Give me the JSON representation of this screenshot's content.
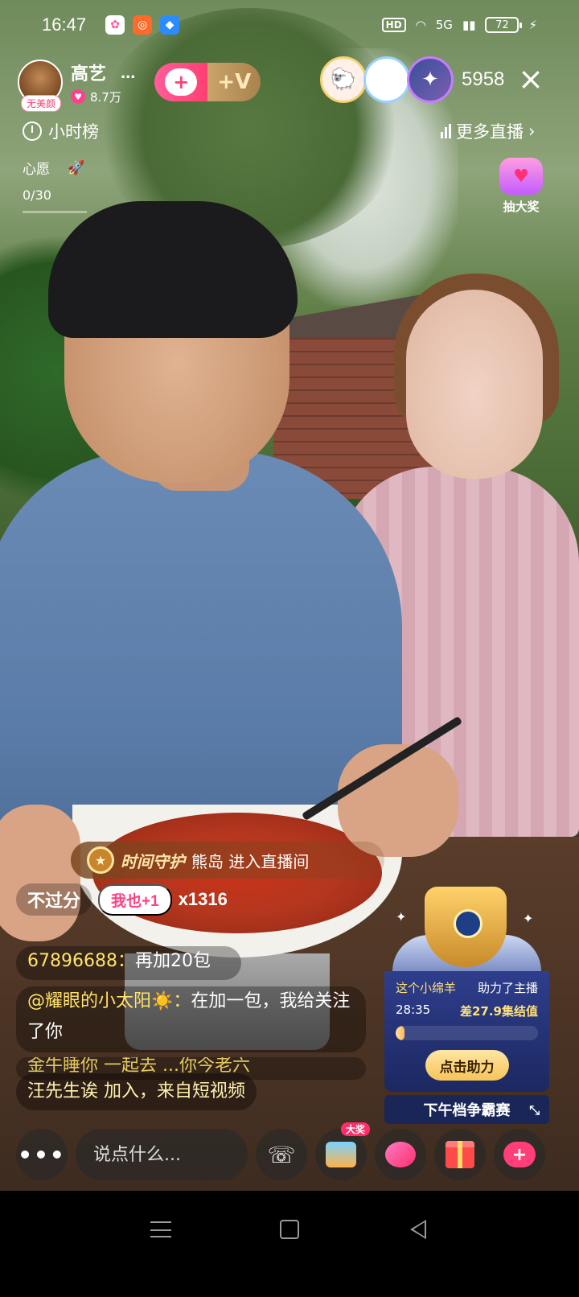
{
  "status_bar": {
    "time": "16:47",
    "network": "5G",
    "hd": "HD",
    "battery": "72"
  },
  "host": {
    "name": "高艺",
    "name_ellipsis": "...",
    "badge": "无美颜",
    "fans": "8.7万",
    "follow_plus": "+",
    "vip_label": "+V"
  },
  "viewers": {
    "count": "5958",
    "avatar_icons": [
      "sheep-avatar",
      "cat-avatar",
      "anime-avatar"
    ]
  },
  "hour_rank": {
    "label": "小时榜"
  },
  "more_live": {
    "label": "更多直播",
    "arrow": "›"
  },
  "wish": {
    "label": "心愿",
    "progress_text": "0/30"
  },
  "lottery": {
    "label": "抽大奖"
  },
  "guard_banner": {
    "title": "时间守护",
    "message": "熊岛 进入直播间"
  },
  "combo": {
    "text": "不过分",
    "button": "我也+1",
    "count": "x1316"
  },
  "chat": [
    {
      "user": "67896688",
      "sep": "：",
      "text": "再加20包"
    },
    {
      "user": "@耀眼的小太阳☀️",
      "sep": "：",
      "text": "在加一包，我给关注了你"
    },
    {
      "user": "",
      "sep": "",
      "text": "金牛睡你 一起去 ...你今老六"
    }
  ],
  "join_message": "汪先生诶 加入，来自短视频",
  "contest": {
    "lamb": "这个小绵羊",
    "helped": "助力了主播",
    "timer": "28:35",
    "gap": "差27.9集结值",
    "progress_fraction": 0.06,
    "help_button": "点击助力",
    "footer": "下午档争霸赛",
    "expand_icon": "⤡"
  },
  "bottom_bar": {
    "more_dots": "•••",
    "input_placeholder": "说点什么...",
    "big_prize_badge": "大奖"
  },
  "colors": {
    "accent_pink": "#ff3f78",
    "chat_username": "#ffe46b",
    "contest_bg": "#2e3e8c",
    "gold": "#f6c45a"
  }
}
